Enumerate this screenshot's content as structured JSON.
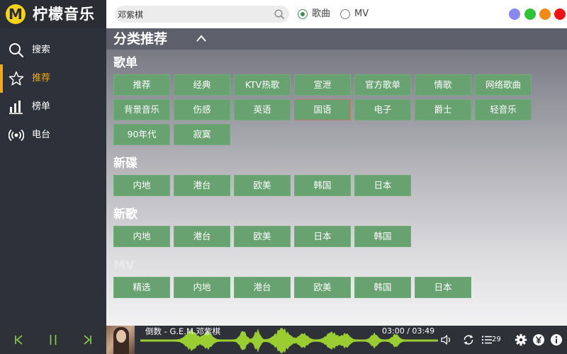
{
  "app": {
    "name": "柠檬音乐",
    "logo_letter": "M"
  },
  "sidebar": {
    "items": [
      {
        "label": "搜索",
        "icon": "search-icon",
        "active": false
      },
      {
        "label": "推荐",
        "icon": "star-icon",
        "active": true
      },
      {
        "label": "榜单",
        "icon": "chart-bars-icon",
        "active": false
      },
      {
        "label": "电台",
        "icon": "radio-broadcast-icon",
        "active": false
      }
    ]
  },
  "topbar": {
    "search_value": "邓紫棋",
    "search_type_options": [
      {
        "label": "歌曲",
        "checked": true
      },
      {
        "label": "MV",
        "checked": false
      }
    ],
    "window_buttons": [
      "#8a86f2",
      "#31c23a",
      "#f28a16",
      "#ee1212"
    ]
  },
  "main": {
    "title": "分类推荐",
    "sections": [
      {
        "title": "歌单",
        "tags": [
          "推荐",
          "经典",
          "KTV热歌",
          "宣泄",
          "官方歌单",
          "情歌",
          "网络歌曲",
          "背景音乐",
          "伤感",
          "英语",
          "国语",
          "电子",
          "爵士",
          "轻音乐",
          "90年代",
          "寂寞"
        ]
      },
      {
        "title": "新碟",
        "tags": [
          "内地",
          "港台",
          "欧美",
          "韩国",
          "日本"
        ]
      },
      {
        "title": "新歌",
        "tags": [
          "内地",
          "港台",
          "欧美",
          "日本",
          "韩国"
        ]
      },
      {
        "title": "MV",
        "tags": [
          "精选",
          "内地",
          "港台",
          "欧美",
          "韩国",
          "日本"
        ]
      }
    ]
  },
  "player": {
    "song": "倒数 - G.E.M.邓紫棋",
    "current_time": "03:00",
    "total_time": "03:49",
    "time_separator": " / ",
    "playlist_count": "29",
    "accent_color": "#9acd32"
  }
}
